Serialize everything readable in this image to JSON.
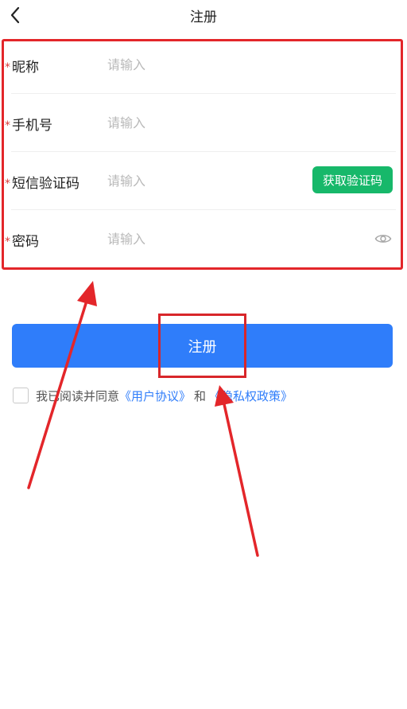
{
  "header": {
    "title": "注册"
  },
  "form": {
    "rows": [
      {
        "label": "昵称",
        "placeholder": "请输入"
      },
      {
        "label": "手机号",
        "placeholder": "请输入"
      },
      {
        "label": "短信验证码",
        "placeholder": "请输入"
      },
      {
        "label": "密码",
        "placeholder": "请输入"
      }
    ],
    "required_mark": "*",
    "sms_button_label": "获取验证码"
  },
  "submit_label": "注册",
  "agreement": {
    "prefix": "我已阅读并同意",
    "user_agreement": "《用户协议》",
    "conjunction": "和",
    "privacy_policy": "《隐私权政策》",
    "checked": false
  },
  "colors": {
    "primary": "#2f7dfa",
    "sms_button": "#17b86a",
    "required": "#d93a3a",
    "annotation": "#e3262a"
  },
  "icons": {
    "back": "chevron-left-icon",
    "password_toggle": "eye-icon"
  }
}
